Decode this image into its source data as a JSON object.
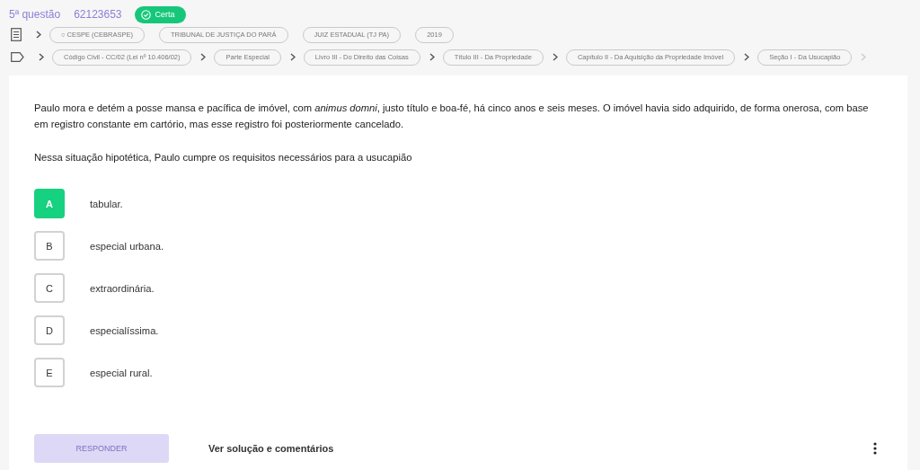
{
  "header": {
    "question_number": "5ª questão",
    "question_id": "62123653",
    "result_badge": {
      "label": "Certa",
      "kind": "correct"
    }
  },
  "source_chips": [
    "○ CESPE (CEBRASPE)",
    "TRIBUNAL DE JUSTIÇA DO PARÁ",
    "JUIZ ESTADUAL (TJ PA)",
    "2019"
  ],
  "subject_chips": [
    "Código Civil - CC/02 (Lei nº 10.406/02)",
    "Parte Especial",
    "Livro III - Do Direito das Coisas",
    "Título III - Da Propriedade",
    "Capítulo II - Da Aquisição da Propriedade Imóvel",
    "Seção I - Da Usucapião"
  ],
  "question": {
    "paragraphs": [
      "Paulo mora e detém a posse mansa e pacífica de imóvel, com *animus domni*, justo título e boa-fé, há cinco anos e seis meses. O imóvel havia sido adquirido, de forma onerosa, com base em registro constante em cartório, mas esse registro foi posteriormente cancelado.",
      "Nessa situação hipotética, Paulo cumpre os requisitos necessários para a usucapião"
    ]
  },
  "alternatives": [
    {
      "letter": "A",
      "text": "tabular.",
      "selected": true
    },
    {
      "letter": "B",
      "text": "especial urbana.",
      "selected": false
    },
    {
      "letter": "C",
      "text": "extraordinária.",
      "selected": false
    },
    {
      "letter": "D",
      "text": "especialíssima.",
      "selected": false
    },
    {
      "letter": "E",
      "text": "especial rural.",
      "selected": false
    }
  ],
  "footer": {
    "answer_button": {
      "label": "RESPONDER",
      "disabled": true
    },
    "solution_link": "Ver solução e comentários"
  }
}
